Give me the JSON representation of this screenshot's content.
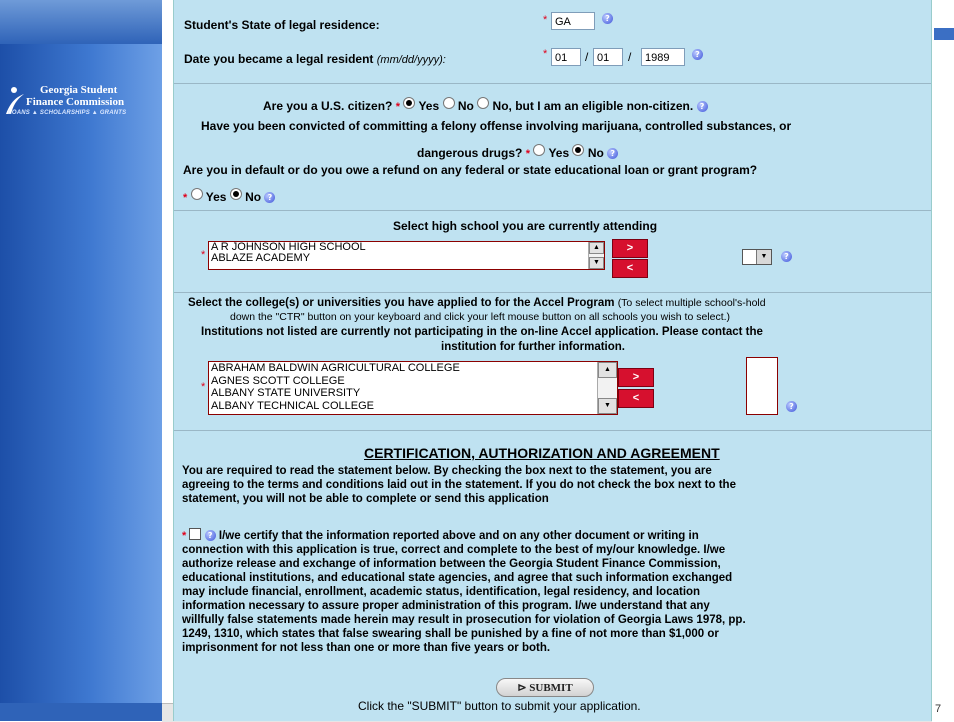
{
  "brand": {
    "line1": "Georgia Student",
    "line2": "Finance Commission",
    "tagline": "LOANS ▲ SCHOLARSHIPS ▲ GRANTS"
  },
  "page_number": "7",
  "residence": {
    "state_label": "Student's State of legal residence:",
    "state_value": "GA",
    "date_label": "Date you became a legal resident",
    "date_hint": "(mm/dd/yyyy):",
    "month": "01",
    "day": "01",
    "year": "1989",
    "sep": "/"
  },
  "citizenship": {
    "question": "Are you a U.S. citizen?",
    "options": [
      "Yes",
      "No",
      "No, but I am an eligible non-citizen."
    ],
    "selected": "Yes"
  },
  "felony": {
    "question_line1": "Have you been convicted of committing a felony offense involving marijuana, controlled substances, or",
    "question_line2": "dangerous drugs?",
    "options": [
      "Yes",
      "No"
    ],
    "selected": "No"
  },
  "default": {
    "question": "Are you in default or do you owe a refund on any federal or state educational loan or grant program?",
    "options": [
      "Yes",
      "No"
    ],
    "selected": "No"
  },
  "high_school": {
    "title": "Select high school you are currently attending",
    "items": [
      "A R JOHNSON HIGH SCHOOL",
      "ABLAZE ACADEMY"
    ],
    "add_label": ">",
    "remove_label": "<"
  },
  "college": {
    "title_bold": "Select the college(s) or universities you have applied to for the Accel Program",
    "title_note1": "(To select multiple school's-hold",
    "title_note2": "down the \"CTR\" button on your keyboard and click your left mouse button on all schools you wish to select.)",
    "notice_line1": "Institutions not listed are currently not participating in the on-line Accel application. Please contact the",
    "notice_line2": "institution for further information.",
    "items": [
      "ABRAHAM BALDWIN AGRICULTURAL COLLEGE",
      "AGNES SCOTT COLLEGE",
      "ALBANY STATE UNIVERSITY",
      "ALBANY TECHNICAL COLLEGE"
    ],
    "add_label": ">",
    "remove_label": "<"
  },
  "certification": {
    "heading": "CERTIFICATION, AUTHORIZATION AND AGREEMENT",
    "intro_lines": [
      "You are required to read the statement below. By checking the box next to the statement, you are",
      "agreeing to the terms and conditions laid out in the statement. If you do not check the box next to the",
      "statement, you will not be able to complete or send this application"
    ],
    "statement_lines": [
      "I/we certify that the information reported above and on any other document or writing in",
      "connection with this application is true, correct and complete to the best of my/our knowledge. I/we",
      "authorize release and exchange of information between the Georgia Student Finance Commission,",
      "educational institutions, and educational state agencies, and agree that such information exchanged",
      "may include financial, enrollment, academic status, identification, legal residency, and location",
      "information necessary to assure proper administration of this program. I/we understand that any",
      "willfully false statements made herein may result in prosecution for violation of Georgia Laws 1978, pp.",
      "1249, 1310, which states that false swearing shall be punished by a fine of not more than $1,000 or",
      "imprisonment for not less than one or more than five years or both."
    ],
    "checked": false
  },
  "submit": {
    "label": "SUBMIT",
    "instruction": "Click the \"SUBMIT\" button to submit your application."
  },
  "glyphs": {
    "required": "*",
    "info": "?",
    "arrow_up": "▲",
    "arrow_down": "▼",
    "submit_arrow": "⊳"
  }
}
